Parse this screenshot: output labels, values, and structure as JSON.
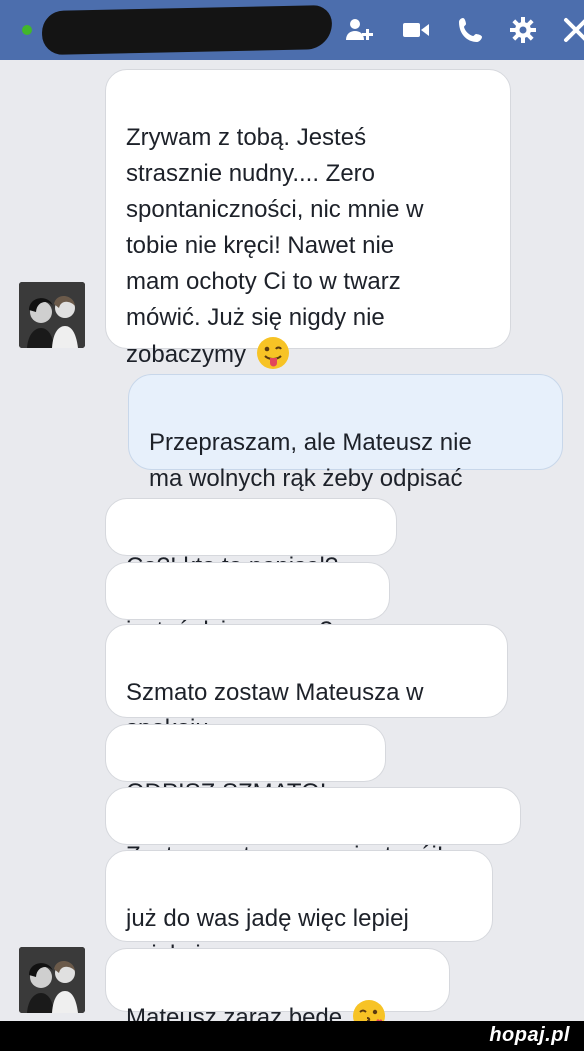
{
  "header": {
    "contact_name": "",
    "status": "online",
    "icons": [
      "add-people-icon",
      "video-call-icon",
      "phone-call-icon",
      "settings-gear-icon",
      "close-icon"
    ]
  },
  "messages": [
    {
      "from": "them",
      "text": "Zrywam z tobą. Jesteś\nstrasznie nudny.... Zero\nspontaniczności, nic mnie w\ntobie nie kręci! Nawet nie\nmam ochoty Ci to w twarz\nmówić. Już się nigdy nie\nzobaczymy",
      "emoji": "tongue-out-emoji"
    },
    {
      "from": "me",
      "text": "Przepraszam, ale Mateusz nie\nma wolnych rąk żeby odpisać"
    },
    {
      "from": "them",
      "text": "Co?! kto to napisał?"
    },
    {
      "from": "them",
      "text": "jesteś dziewczyną?"
    },
    {
      "from": "them",
      "text": "Szmato zostaw Mateusza w\nspokoju"
    },
    {
      "from": "them",
      "text": "ODPISZ SZMATO!"
    },
    {
      "from": "them",
      "text": "Zostaw mateusza on jest mój!"
    },
    {
      "from": "them",
      "text": "już do was jadę więc lepiej\nuciekaj"
    },
    {
      "from": "them",
      "text": "Mateusz zaraz będę",
      "emoji": "kiss-emoji"
    }
  ],
  "watermark": "hopaj.pl",
  "colors": {
    "header": "#4c6ead",
    "background": "#e9eaee",
    "incoming_bubble": "#ffffff",
    "outgoing_bubble": "#e7f0fb",
    "online": "#42b72a"
  }
}
